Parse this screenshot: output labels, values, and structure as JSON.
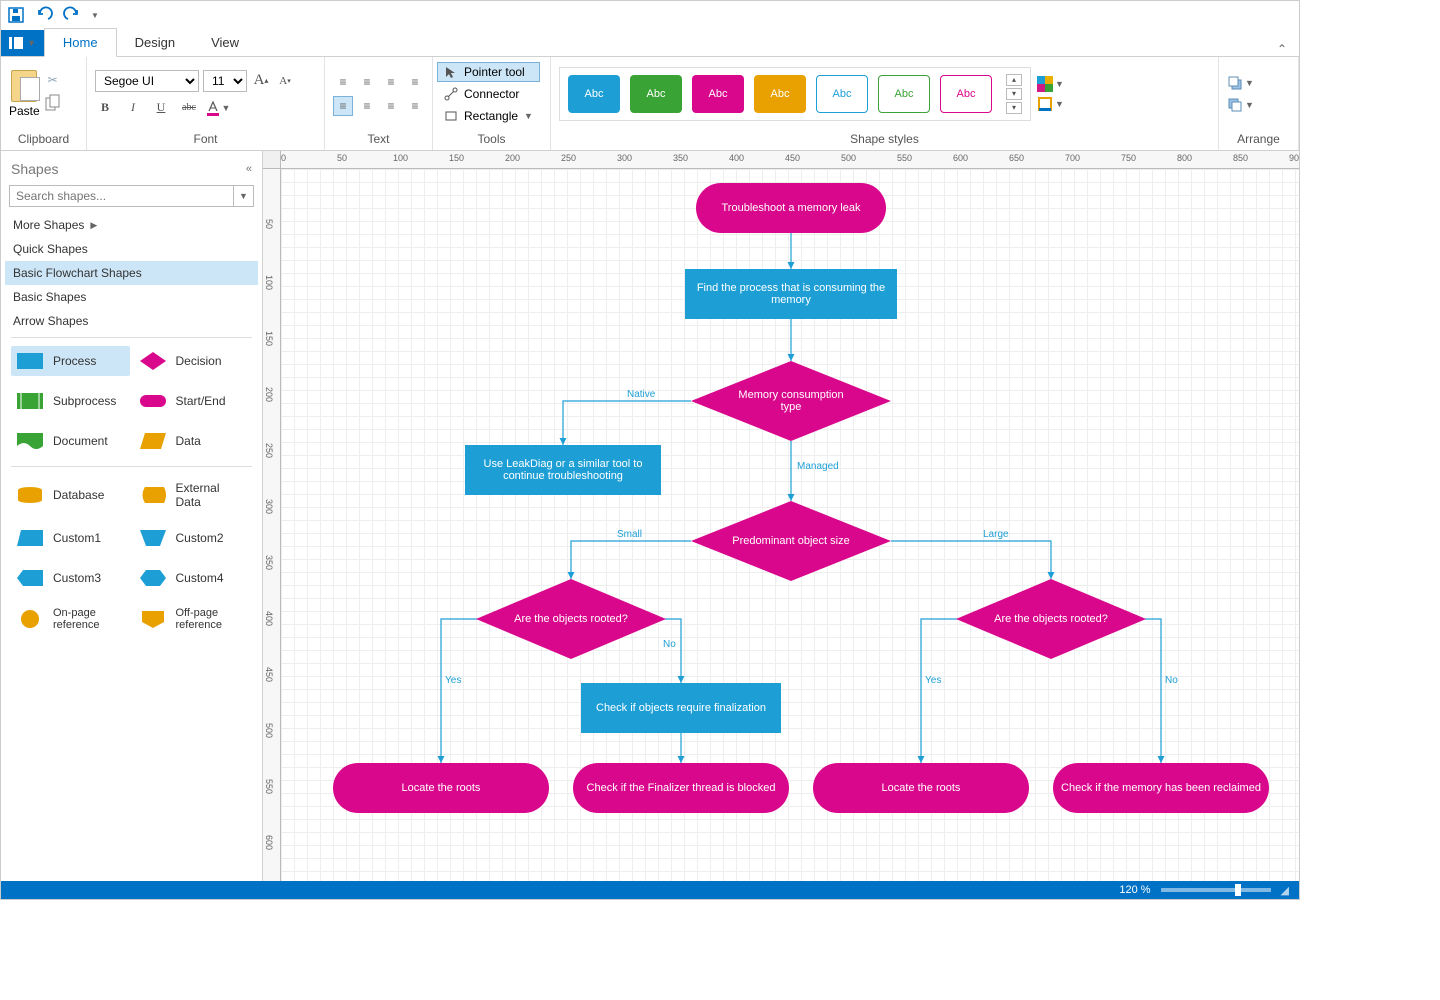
{
  "ribbon": {
    "tabs": [
      "Home",
      "Design",
      "View"
    ],
    "active_tab": "Home",
    "groups": {
      "clipboard": "Clipboard",
      "font": "Font",
      "text": "Text",
      "tools": "Tools",
      "styles": "Shape styles",
      "arrange": "Arrange"
    },
    "paste": "Paste",
    "font_name": "Segoe UI",
    "font_size": "11",
    "tools": {
      "pointer": "Pointer tool",
      "connector": "Connector",
      "rectangle": "Rectangle"
    },
    "swatch_label": "Abc",
    "swatch_colors": [
      "#1d9fd6",
      "#3aa335",
      "#d9078b",
      "#e8a100",
      "#1d9fd6",
      "#3aa335",
      "#d9078b"
    ]
  },
  "shapes_panel": {
    "title": "Shapes",
    "search_placeholder": "Search shapes...",
    "more": "More Shapes",
    "categories": [
      "Quick Shapes",
      "Basic Flowchart Shapes",
      "Basic Shapes",
      "Arrow Shapes"
    ],
    "selected_category": "Basic Flowchart Shapes",
    "items": [
      "Process",
      "Decision",
      "Subprocess",
      "Start/End",
      "Document",
      "Data",
      "Database",
      "External Data",
      "Custom1",
      "Custom2",
      "Custom3",
      "Custom4",
      "On-page reference",
      "Off-page reference"
    ],
    "selected_item": "Process"
  },
  "flow": {
    "n1": "Troubleshoot a memory leak",
    "n2": "Find the process that is consuming the memory",
    "n3": "Memory consumption type",
    "n3a": "Native",
    "n3b": "Managed",
    "n4": "Use LeakDiag or a similar tool to continue troubleshooting",
    "n5": "Predominant object size",
    "n5a": "Small",
    "n5b": "Large",
    "n6": "Are the objects rooted?",
    "n7": "Are the objects rooted?",
    "yes": "Yes",
    "no": "No",
    "t1": "Locate the roots",
    "t2": "Check if the Finalizer thread is blocked",
    "t3": "Locate the roots",
    "t4": "Check if the memory has been reclaimed",
    "p1": "Check if objects require finalization"
  },
  "status": {
    "zoom": "120 %"
  },
  "ruler_major": 50
}
